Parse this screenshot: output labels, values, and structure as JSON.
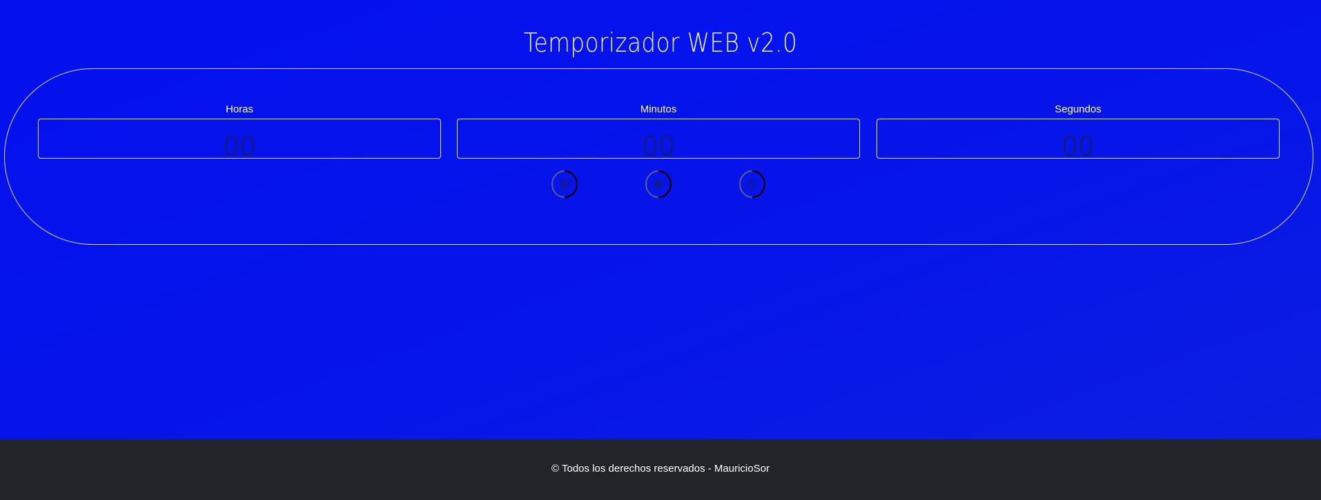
{
  "header": {
    "title": "Temporizador WEB v2.0"
  },
  "timer": {
    "fields": [
      {
        "label": "Horas",
        "value": "00"
      },
      {
        "label": "Minutos",
        "value": "00"
      },
      {
        "label": "Segundos",
        "value": "00"
      }
    ],
    "controls": [
      {
        "icon": "play-icon"
      },
      {
        "icon": "pause-icon"
      },
      {
        "icon": "reset-icon"
      }
    ]
  },
  "footer": {
    "text": "© Todos los derechos reservados - MauricioSor"
  },
  "colors": {
    "background": "#0410ee",
    "footer": "#212529",
    "border": "#ffffff",
    "value_text": "#1a1f4a"
  }
}
